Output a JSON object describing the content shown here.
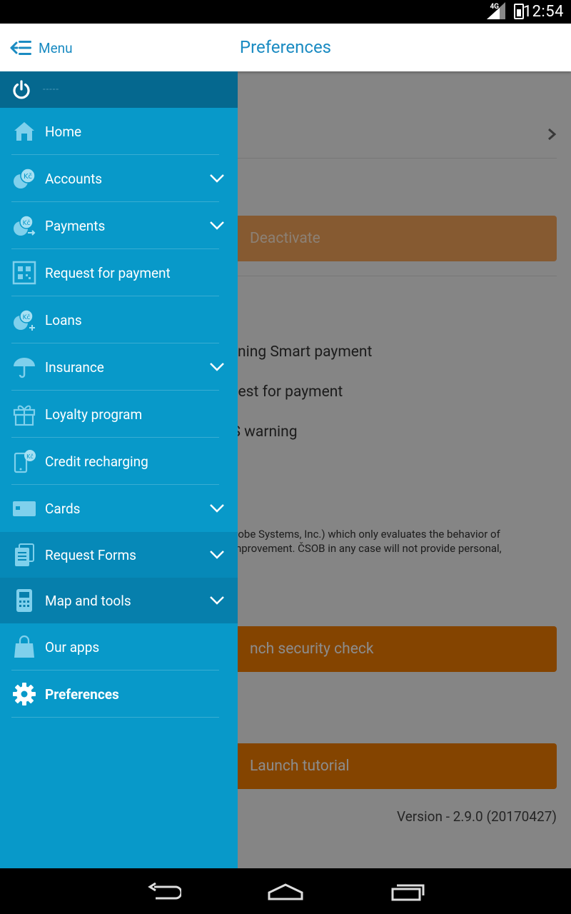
{
  "status_bar": {
    "time": "12:54",
    "network": "4G"
  },
  "app_bar": {
    "menu_label": "Menu",
    "title": "Preferences"
  },
  "drawer": {
    "user_name": "-----",
    "items": [
      {
        "label": "Home",
        "icon": "home-icon",
        "expandable": false
      },
      {
        "label": "Accounts",
        "icon": "accounts-icon",
        "expandable": true
      },
      {
        "label": "Payments",
        "icon": "payments-icon",
        "expandable": true
      },
      {
        "label": "Request for payment",
        "icon": "qr-code-icon",
        "expandable": false
      },
      {
        "label": "Loans",
        "icon": "loans-icon",
        "expandable": false
      },
      {
        "label": "Insurance",
        "icon": "umbrella-icon",
        "expandable": true
      },
      {
        "label": "Loyalty program",
        "icon": "gift-icon",
        "expandable": false
      },
      {
        "label": "Credit recharging",
        "icon": "phone-recharge-icon",
        "expandable": false
      },
      {
        "label": "Cards",
        "icon": "card-icon",
        "expandable": true
      },
      {
        "label": "Request Forms",
        "icon": "documents-icon",
        "expandable": true
      },
      {
        "label": "Map and tools",
        "icon": "calculator-icon",
        "expandable": true
      },
      {
        "label": "Our apps",
        "icon": "shopping-bag-icon",
        "expandable": false
      },
      {
        "label": "Preferences",
        "icon": "gear-icon",
        "expandable": false
      }
    ]
  },
  "content": {
    "deactivate_button": "Deactivate",
    "options": [
      "anning Smart payment",
      "quest for payment",
      "OS warning"
    ],
    "paragraph_line1": "(Adobe Systems, Inc.) which only evaluates the behavior of",
    "paragraph_line2": "s improvement. ČSOB in any case will not provide personal,",
    "security_button": "nch security check",
    "tutorial_button": "Launch tutorial",
    "version": "Version - 2.9.0 (20170427)"
  },
  "colors": {
    "drawer": "#0899c9",
    "drawer_header": "#05688f",
    "accent": "#1a8bc2",
    "orange": "#f07c00"
  }
}
